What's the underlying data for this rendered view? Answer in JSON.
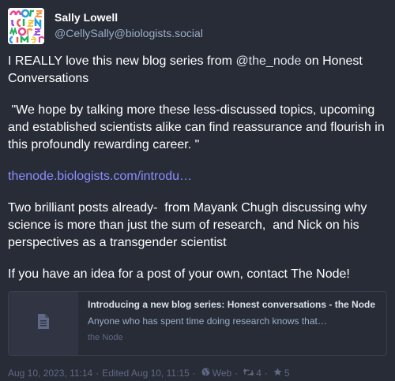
{
  "author": {
    "display_name": "Sally Lowell",
    "handle": "@CellySally@biologists.social"
  },
  "post": {
    "paragraph_1_text": "I REALLY love this new blog series from ",
    "paragraph_1_mention": "@the_node",
    "paragraph_1_tail": " on Honest Conversations",
    "quote": " \"We hope by talking more these less-discussed topics, upcoming and established scientists alike can find reassurance and flourish in this profoundly rewarding career. \"",
    "link_text": "thenode.biologists.com/introdu…",
    "paragraph_3": "Two brilliant posts already-  from Mayank Chugh discussing why science is more than just the sum of research,  and Nick on his perspectives as a transgender scientist",
    "paragraph_4": "If you have an idea for a post of your own, contact The Node!"
  },
  "card": {
    "title": "Introducing a new blog series: Honest conversations - the Node",
    "description": "Anyone who has spent time doing research knows that…",
    "provider": "the Node",
    "icon": "document-icon"
  },
  "meta": {
    "created": "Aug 10, 2023, 11:14",
    "edited": "Edited Aug 10, 11:15",
    "visibility_icon": "globe-icon",
    "application": "Web",
    "boost_icon": "retweet-icon",
    "boosts": "4",
    "favourite_icon": "star-icon",
    "favourites": "5"
  },
  "colors": {
    "background": "#282c37",
    "link": "#8c8dff",
    "secondary_text": "#9baec8",
    "muted_text": "#606984"
  }
}
